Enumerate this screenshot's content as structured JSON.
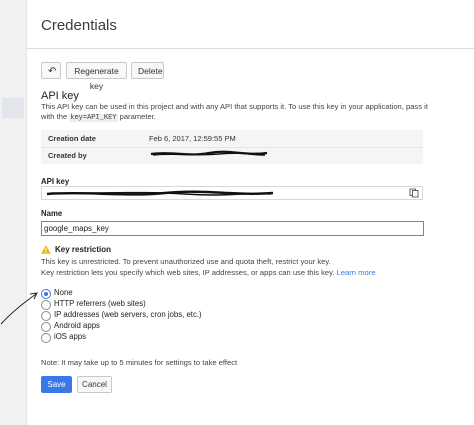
{
  "header": {
    "title": "Credentials"
  },
  "toolbar": {
    "back_icon": "arrow-left",
    "regenerate_label": "Regenerate key",
    "delete_label": "Delete"
  },
  "api_key_section": {
    "title": "API key",
    "description_before": "This API key can be used in this project and with any API that supports it. To use this key in your application, pass it with the ",
    "description_code": "key=API_KEY",
    "description_after": " parameter."
  },
  "meta": {
    "creation_date_label": "Creation date",
    "creation_date_value": "Feb 6, 2017, 12:59:55 PM",
    "created_by_label": "Created by"
  },
  "api_key_field": {
    "label": "API key",
    "copy_icon": "copy"
  },
  "name_field": {
    "label": "Name",
    "value": "google_maps_key"
  },
  "restriction": {
    "warning_icon": "warning",
    "title": "Key restriction",
    "line1": "This key is unrestricted. To prevent unauthorized use and quota theft, restrict your key.",
    "line2": "Key restriction lets you specify which web sites, IP addresses, or apps can use this key.",
    "learn_more": "Learn more",
    "options": [
      {
        "label": "None",
        "selected": true
      },
      {
        "label": "HTTP referrers (web sites)",
        "selected": false
      },
      {
        "label": "IP addresses (web servers, cron jobs, etc.)",
        "selected": false
      },
      {
        "label": "Android apps",
        "selected": false
      },
      {
        "label": "iOS apps",
        "selected": false
      }
    ]
  },
  "note": "Note: It may take up to 5 minutes for settings to take effect",
  "actions": {
    "save_label": "Save",
    "cancel_label": "Cancel"
  },
  "colors": {
    "accent": "#3b78e7",
    "warning": "#f4b400",
    "link": "#3a78d8"
  }
}
